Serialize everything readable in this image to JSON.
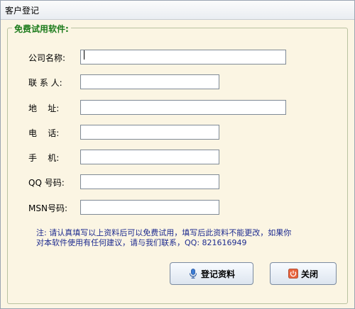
{
  "window": {
    "title": "客户登记"
  },
  "group": {
    "legend": "免费试用软件:"
  },
  "form": {
    "company_label": "公司名称:",
    "contact_label": "联 系 人:",
    "address_label": "地    址:",
    "phone_label": "电    话:",
    "mobile_label": "手    机:",
    "qq_label": "QQ 号码:",
    "msn_label": "MSN号码:",
    "company_value": "",
    "contact_value": "",
    "address_value": "",
    "phone_value": "",
    "mobile_value": "",
    "qq_value": "",
    "msn_value": ""
  },
  "note": {
    "line1": "注: 请认真填写以上资料后可以免费试用，填写后此资料不能更改，如果你",
    "line2": "对本软件使用有任何建议，请与我们联系，QQ: 821616949"
  },
  "buttons": {
    "register_label": "登记资料",
    "close_label": "关闭"
  },
  "colors": {
    "legend": "#1a7a1a",
    "note": "#1d2a8f",
    "background": "#fbf5e3"
  },
  "icons": {
    "register": "microphone-icon",
    "close": "power-icon"
  }
}
